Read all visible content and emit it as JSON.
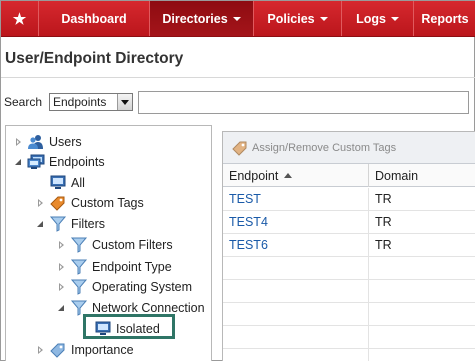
{
  "nav": {
    "home_icon": "star-icon",
    "items": [
      "Dashboard",
      "Directories",
      "Policies",
      "Logs",
      "Reports"
    ],
    "active": "Directories",
    "accent_color": "#c41e24"
  },
  "page": {
    "title": "User/Endpoint Directory"
  },
  "search": {
    "label": "Search",
    "scope": "Endpoints",
    "value": ""
  },
  "tree": {
    "nodes": [
      {
        "label": "Users",
        "icon": "users-icon",
        "state": "collapsed"
      },
      {
        "label": "Endpoints",
        "icon": "computers-icon",
        "state": "expanded"
      },
      {
        "label": "All",
        "icon": "computer-icon",
        "state": "none"
      },
      {
        "label": "Custom Tags",
        "icon": "tag-icon",
        "state": "collapsed"
      },
      {
        "label": "Filters",
        "icon": "filter-icon",
        "state": "expanded"
      },
      {
        "label": "Custom Filters",
        "icon": "filter-icon",
        "state": "collapsed"
      },
      {
        "label": "Endpoint Type",
        "icon": "filter-icon",
        "state": "collapsed"
      },
      {
        "label": "Operating System",
        "icon": "filter-icon",
        "state": "collapsed"
      },
      {
        "label": "Network Connection",
        "icon": "filter-icon",
        "state": "expanded"
      },
      {
        "label": "Isolated",
        "icon": "computer-icon",
        "state": "none",
        "highlighted": true
      },
      {
        "label": "Importance",
        "icon": "tag-icon",
        "state": "collapsed"
      }
    ]
  },
  "grid": {
    "toolbar_button": "Assign/Remove Custom Tags",
    "columns": [
      "Endpoint",
      "Domain"
    ],
    "sort": {
      "column": "Endpoint",
      "direction": "ascending"
    },
    "rows": [
      {
        "endpoint": "TEST",
        "domain": "TR"
      },
      {
        "endpoint": "TEST4",
        "domain": "TR"
      },
      {
        "endpoint": "TEST6",
        "domain": "TR"
      }
    ],
    "empty_rows": 5
  }
}
